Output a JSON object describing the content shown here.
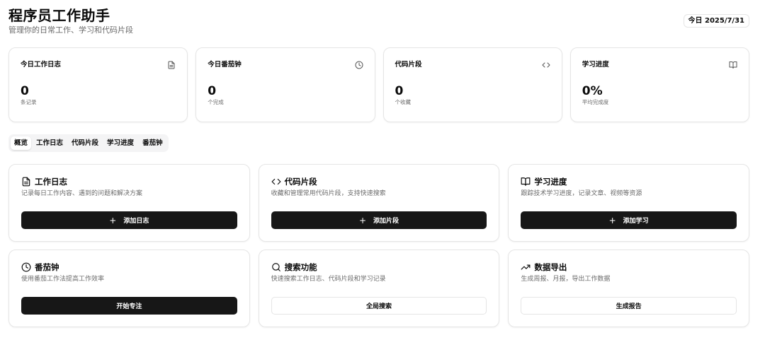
{
  "header": {
    "title": "程序员工作助手",
    "subtitle": "管理你的日常工作、学习和代码片段",
    "date_badge": "今日 2025/7/31"
  },
  "stats": [
    {
      "label": "今日工作日志",
      "value": "0",
      "unit": "条记录",
      "icon": "file-text-icon"
    },
    {
      "label": "今日番茄钟",
      "value": "0",
      "unit": "个完成",
      "icon": "clock-icon"
    },
    {
      "label": "代码片段",
      "value": "0",
      "unit": "个收藏",
      "icon": "code-icon"
    },
    {
      "label": "学习进度",
      "value": "0%",
      "unit": "平均完成度",
      "icon": "book-open-icon"
    }
  ],
  "tabs": [
    {
      "label": "概览",
      "active": true
    },
    {
      "label": "工作日志",
      "active": false
    },
    {
      "label": "代码片段",
      "active": false
    },
    {
      "label": "学习进度",
      "active": false
    },
    {
      "label": "番茄钟",
      "active": false
    }
  ],
  "features": [
    {
      "title": "工作日志",
      "desc": "记录每日工作内容、遇到的问题和解决方案",
      "button": "添加日志",
      "plus": "+",
      "icon": "file-text-icon",
      "style": "primary"
    },
    {
      "title": "代码片段",
      "desc": "收藏和管理常用代码片段，支持快速搜索",
      "button": "添加片段",
      "plus": "+",
      "icon": "code-icon",
      "style": "primary"
    },
    {
      "title": "学习进度",
      "desc": "跟踪技术学习进度，记录文章、视频等资源",
      "button": "添加学习",
      "plus": "+",
      "icon": "book-open-icon",
      "style": "primary"
    },
    {
      "title": "番茄钟",
      "desc": "使用番茄工作法提高工作效率",
      "button": "开始专注",
      "icon": "clock-icon",
      "style": "primary"
    },
    {
      "title": "搜索功能",
      "desc": "快速搜索工作日志、代码片段和学习记录",
      "button": "全局搜索",
      "icon": "search-icon",
      "style": "outline"
    },
    {
      "title": "数据导出",
      "desc": "生成周报、月报，导出工作数据",
      "button": "生成报告",
      "icon": "trending-up-icon",
      "style": "outline"
    }
  ],
  "colors": {
    "primary_button": "#171717",
    "muted_text": "#6b6b6b",
    "border": "#e5e5e5",
    "tab_bg": "#f4f4f5"
  }
}
